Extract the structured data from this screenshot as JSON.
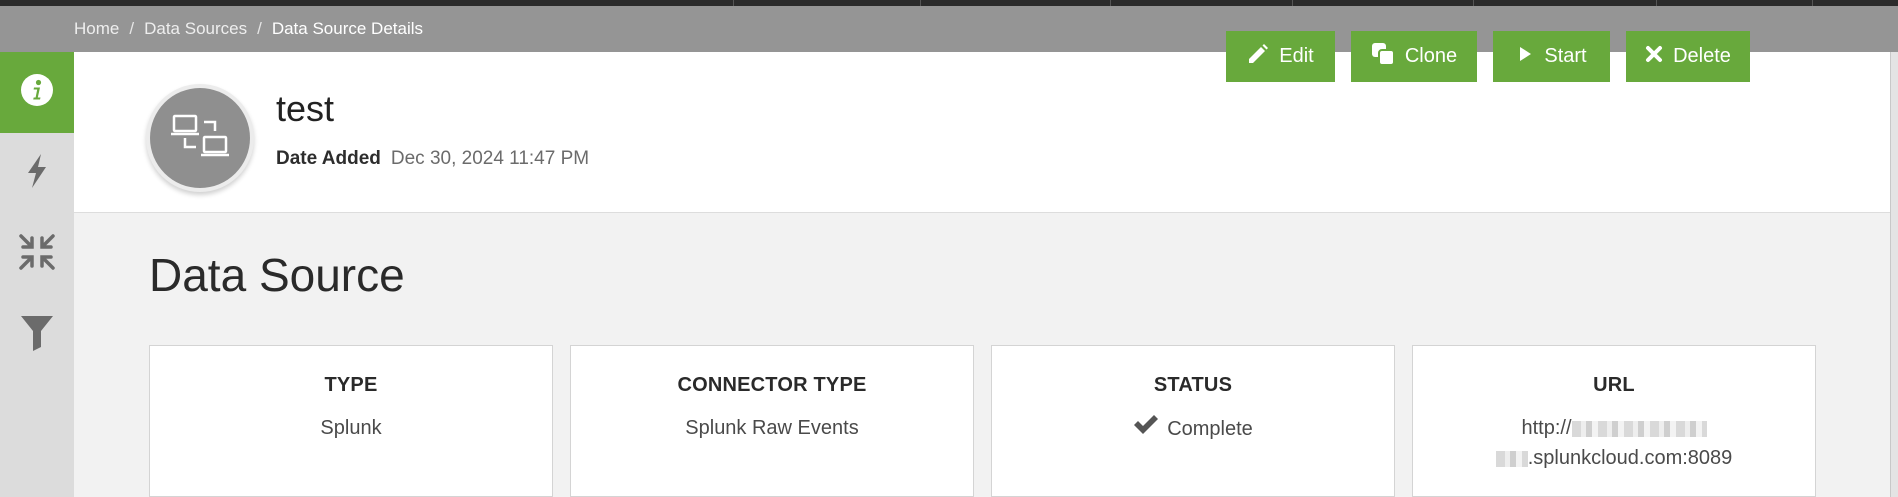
{
  "breadcrumb": {
    "items": [
      "Home",
      "Data Sources"
    ],
    "separator": "/",
    "current": "Data Source Details"
  },
  "sidebar": {
    "items": [
      {
        "icon": "info-icon",
        "active": true
      },
      {
        "icon": "lightning-icon",
        "active": false
      },
      {
        "icon": "compress-icon",
        "active": false
      },
      {
        "icon": "filter-icon",
        "active": false
      }
    ]
  },
  "header": {
    "title": "test",
    "date_label": "Date Added",
    "date_value": "Dec 30, 2024 11:47 PM",
    "avatar_icon": "connected-computers-icon"
  },
  "actions": {
    "edit": "Edit",
    "clone": "Clone",
    "start": "Start",
    "delete": "Delete"
  },
  "section": {
    "title": "Data Source"
  },
  "cards": {
    "type": {
      "label": "TYPE",
      "value": "Splunk"
    },
    "connector": {
      "label": "CONNECTOR TYPE",
      "value": "Splunk Raw Events"
    },
    "status": {
      "label": "STATUS",
      "value": "Complete",
      "icon": "checkmark-icon"
    },
    "url": {
      "label": "URL",
      "prefix": "http://",
      "suffix": ".splunkcloud.com:8089"
    }
  },
  "colors": {
    "accent": "#68a93c",
    "breadcrumb_bar": "#959595",
    "sidebar": "#dcdcdc"
  }
}
